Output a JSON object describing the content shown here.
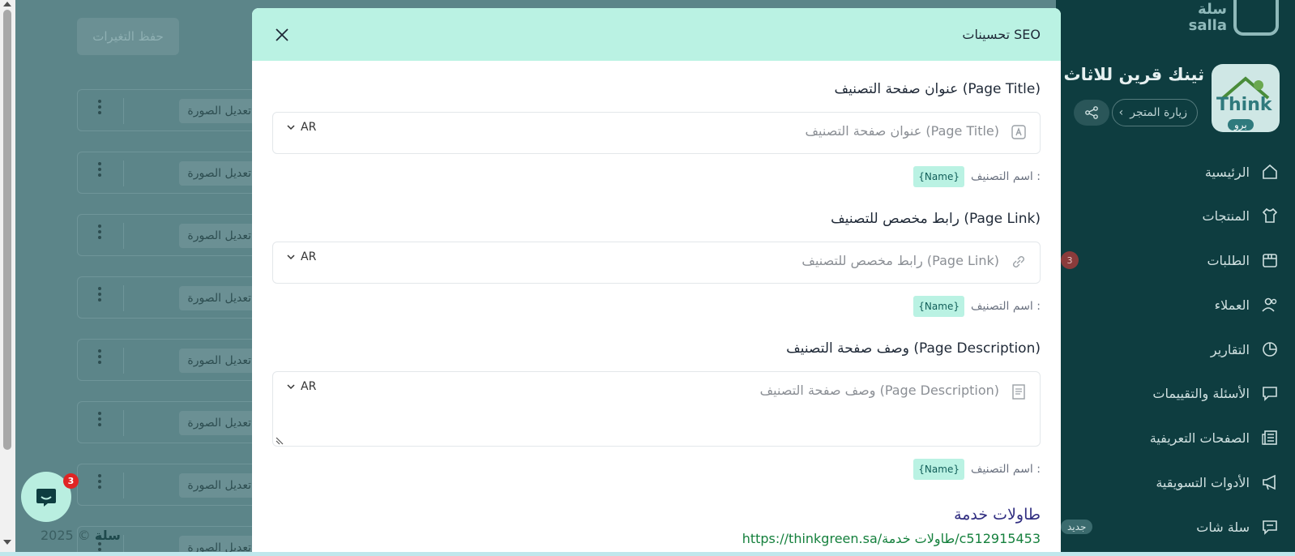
{
  "background": {
    "save_button": "حفظ التغيرات",
    "row_edit_label": "تعديل الصورة",
    "copyright_year": "2025 ©",
    "copyright_brand": "سلة",
    "chat_badge": "3"
  },
  "sidebar": {
    "logo_text": "سلة salla",
    "store_name": "ثينك قرين للاثاث",
    "store_plan": "برو",
    "store_avatar_text": "Think",
    "visit_store": "زيارة المتجر",
    "nav": [
      {
        "label": "الرئيسية",
        "icon": "home-icon"
      },
      {
        "label": "المنتجات",
        "icon": "shirt-icon"
      },
      {
        "label": "الطلبات",
        "icon": "box-icon",
        "count": "3"
      },
      {
        "label": "العملاء",
        "icon": "users-icon"
      },
      {
        "label": "التقارير",
        "icon": "pie-chart-icon"
      },
      {
        "label": "الأسئلة والتقييمات",
        "icon": "message-icon"
      },
      {
        "label": "الصفحات التعريفية",
        "icon": "newspaper-icon"
      },
      {
        "label": "الأدوات التسويقية",
        "icon": "megaphone-icon"
      },
      {
        "label": "سلة شات",
        "icon": "chat-icon",
        "pill": "جديد"
      }
    ]
  },
  "modal": {
    "title": "تحسينات SEO",
    "page_title": {
      "label": "عنوان صفحة التصنيف (Page Title)",
      "placeholder": "عنوان صفحة التصنيف (Page Title)",
      "lang": "AR",
      "hint_label": "اسم التصنيف :",
      "hint_chip": "{Name}"
    },
    "page_link": {
      "label": "رابط مخصص للتصنيف (Page Link)",
      "placeholder": "رابط مخصص للتصنيف (Page Link)",
      "lang": "AR",
      "hint_label": "اسم التصنيف :",
      "hint_chip": "{Name}"
    },
    "page_description": {
      "label": "وصف صفحة التصنيف (Page Description)",
      "placeholder": "وصف صفحة التصنيف (Page Description)",
      "lang": "AR",
      "hint_label": "اسم التصنيف :",
      "hint_chip": "{Name}"
    },
    "preview": {
      "title": "طاولات خدمة",
      "url": "https://thinkgreen.sa/طاولات خدمة/c512915453"
    }
  }
}
